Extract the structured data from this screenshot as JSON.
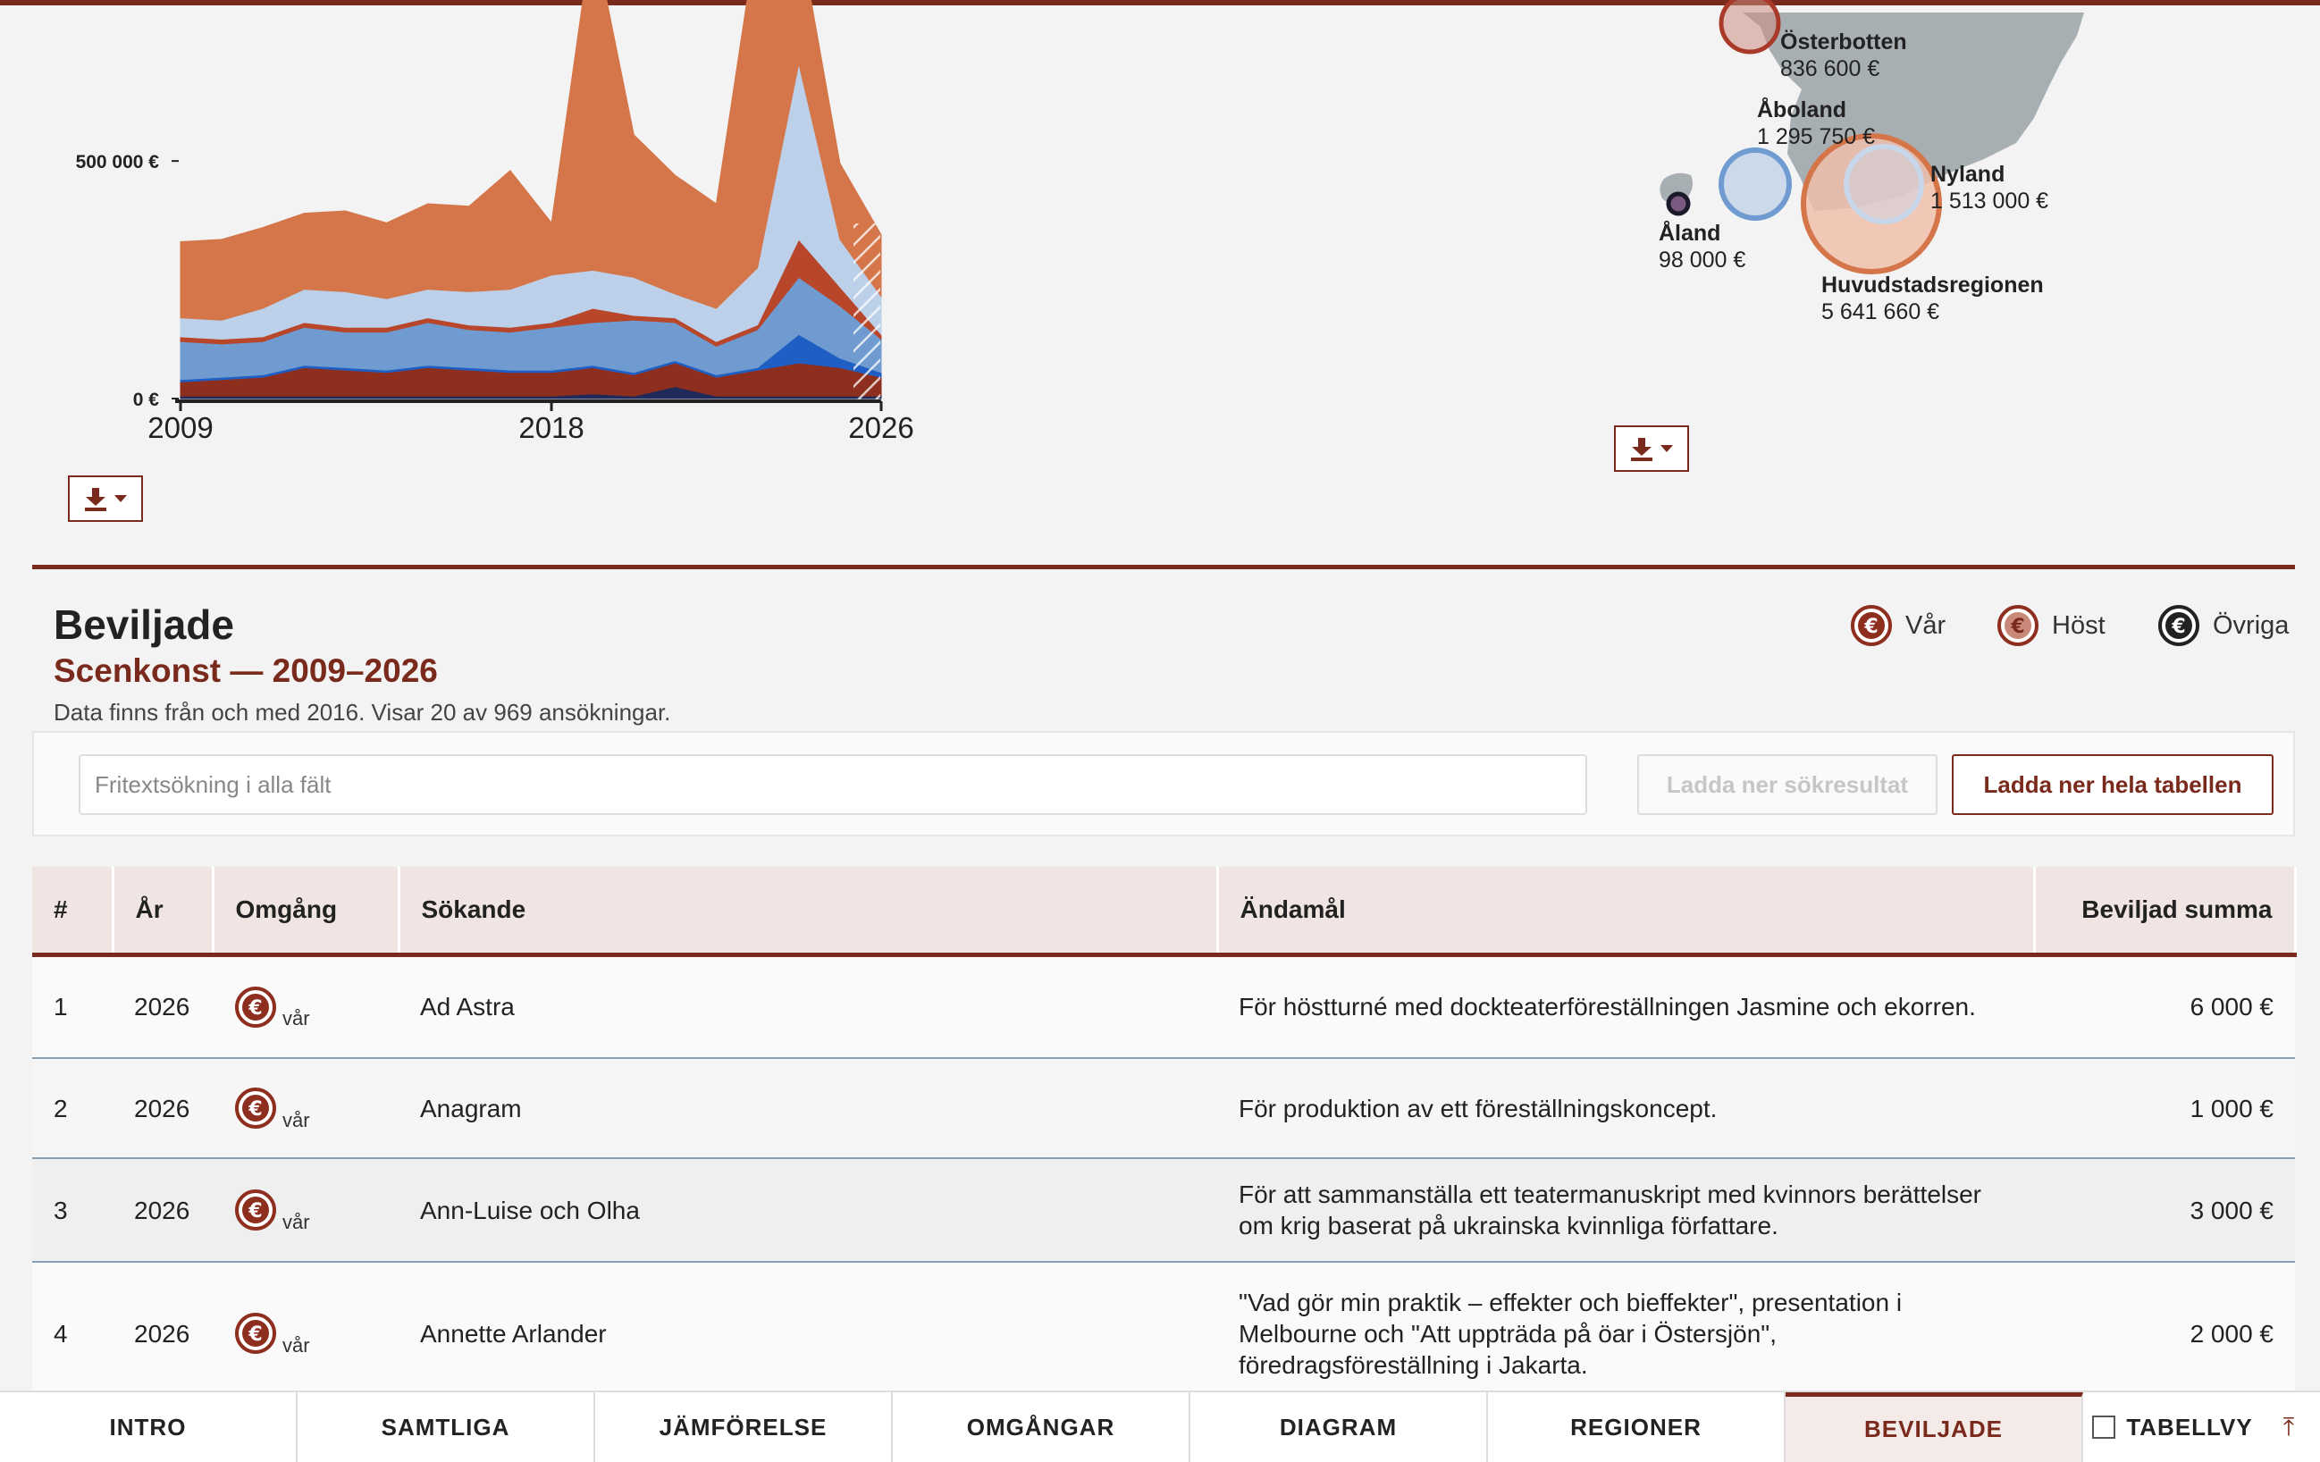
{
  "colors": {
    "brand": "#7a2a1c",
    "orange": "#d4764a",
    "light_blue": "#bcd0ea",
    "mid_blue": "#6f9bd0",
    "red": "#b8462a",
    "dark_red": "#8e2e1f",
    "navy": "#1f2a5a",
    "map_gray": "#a7afb2"
  },
  "chart_data": {
    "type": "area",
    "stacked": true,
    "x": [
      2009,
      2010,
      2011,
      2012,
      2013,
      2014,
      2015,
      2016,
      2017,
      2018,
      2019,
      2020,
      2021,
      2022,
      2023,
      2024,
      2025,
      2026
    ],
    "x_ticks": [
      "2009",
      "2018",
      "2026"
    ],
    "y_ticks": [
      "500 000 €",
      "0 €"
    ],
    "ylim": [
      0,
      820000
    ],
    "series": [
      {
        "color": "#1f2a5a",
        "values": [
          5000,
          5000,
          5000,
          5000,
          5000,
          5000,
          5000,
          5000,
          5000,
          5000,
          10000,
          5000,
          25000,
          5000,
          5000,
          5000,
          5000,
          5000
        ]
      },
      {
        "color": "#8e2e1f",
        "values": [
          30000,
          35000,
          40000,
          60000,
          55000,
          50000,
          60000,
          55000,
          50000,
          50000,
          55000,
          45000,
          50000,
          40000,
          55000,
          70000,
          60000,
          40000
        ]
      },
      {
        "color": "#1f5fc4",
        "values": [
          5000,
          5000,
          5000,
          5000,
          5000,
          5000,
          5000,
          5000,
          5000,
          5000,
          5000,
          5000,
          5000,
          5000,
          5000,
          60000,
          20000,
          10000
        ]
      },
      {
        "color": "#6f9bd0",
        "values": [
          80000,
          70000,
          70000,
          80000,
          75000,
          80000,
          90000,
          80000,
          80000,
          90000,
          90000,
          110000,
          80000,
          60000,
          80000,
          120000,
          110000,
          70000
        ]
      },
      {
        "color": "#b8462a",
        "values": [
          10000,
          10000,
          10000,
          10000,
          10000,
          10000,
          10000,
          10000,
          10000,
          10000,
          30000,
          10000,
          10000,
          10000,
          10000,
          80000,
          40000,
          10000
        ]
      },
      {
        "color": "#bcd0ea",
        "values": [
          40000,
          40000,
          60000,
          70000,
          75000,
          60000,
          60000,
          70000,
          80000,
          100000,
          80000,
          80000,
          50000,
          70000,
          120000,
          370000,
          100000,
          80000
        ]
      },
      {
        "color": "#d4764a",
        "values": [
          160000,
          170000,
          170000,
          160000,
          170000,
          160000,
          180000,
          180000,
          250000,
          110000,
          900000,
          300000,
          250000,
          220000,
          800000,
          280000,
          160000,
          130000
        ]
      }
    ]
  },
  "chart_download_icon": "download-icon",
  "map": {
    "regions": [
      {
        "name": "Österbotten",
        "amount": "836 600 €"
      },
      {
        "name": "Åboland",
        "amount": "1 295 750 €"
      },
      {
        "name": "Nyland",
        "amount": "1 513 000 €"
      },
      {
        "name": "Åland",
        "amount": "98 000 €"
      },
      {
        "name": "Huvudstadsregionen",
        "amount": "5 641 660 €"
      }
    ]
  },
  "section": {
    "title": "Beviljade",
    "subtitle": "Scenkonst — 2009–2026",
    "note": "Data finns från och med 2016. Visar 20 av 969 ansökningar."
  },
  "legend": [
    {
      "label": "Vår",
      "icon": "euro-coin-icon",
      "color": "#8e2e1f"
    },
    {
      "label": "Höst",
      "icon": "euro-coin-icon",
      "color": "#c9897a"
    },
    {
      "label": "Övriga",
      "icon": "euro-coin-icon",
      "color": "#222222"
    }
  ],
  "search": {
    "placeholder": "Fritextsökning i alla fält",
    "download_results": "Ladda ner sökresultat",
    "download_all": "Ladda ner hela tabellen"
  },
  "table": {
    "columns": [
      "#",
      "År",
      "Omgång",
      "Sökande",
      "Ändamål",
      "Beviljad summa"
    ],
    "rows": [
      {
        "n": "1",
        "year": "2026",
        "round": "vår",
        "applicant": "Ad Astra",
        "purpose": "För höstturné med dockteaterföreställningen Jasmine och ekorren.",
        "amount": "6 000 €"
      },
      {
        "n": "2",
        "year": "2026",
        "round": "vår",
        "applicant": "Anagram",
        "purpose": "För produktion av ett föreställningskoncept.",
        "amount": "1 000 €"
      },
      {
        "n": "3",
        "year": "2026",
        "round": "vår",
        "applicant": "Ann-Luise och Olha",
        "purpose": "För att sammanställa ett teatermanuskript med kvinnors berättelser om krig baserat på ukrainska kvinnliga författare.",
        "amount": "3 000 €"
      },
      {
        "n": "4",
        "year": "2026",
        "round": "vår",
        "applicant": "Annette Arlander",
        "purpose": "\"Vad gör min praktik – effekter och bieffekter\", presentation i Melbourne och \"Att uppträda på öar i Östersjön\", föredragsföreställning i Jakarta.",
        "amount": "2 000 €"
      }
    ]
  },
  "nav": {
    "tabs": [
      "INTRO",
      "SAMTLIGA",
      "JÄMFÖRELSE",
      "OMGÅNGAR",
      "DIAGRAM",
      "REGIONER",
      "BEVILJADE"
    ],
    "active": "BEVILJADE",
    "table_view": "TABELLVY",
    "top_icon": "arrow-up-icon"
  }
}
